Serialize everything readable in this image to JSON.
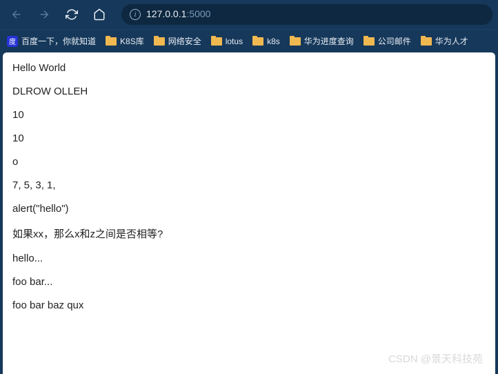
{
  "address": {
    "host": "127.0.0.1",
    "port": ":5000"
  },
  "bookmarks": [
    {
      "label": "百度一下，你就知道",
      "type": "site"
    },
    {
      "label": "K8S库",
      "type": "folder"
    },
    {
      "label": "网络安全",
      "type": "folder"
    },
    {
      "label": "lotus",
      "type": "folder"
    },
    {
      "label": "k8s",
      "type": "folder"
    },
    {
      "label": "华为进度查询",
      "type": "folder"
    },
    {
      "label": "公司邮件",
      "type": "folder"
    },
    {
      "label": "华为人才",
      "type": "folder"
    }
  ],
  "content_lines": [
    "Hello World",
    "DLROW OLLEH",
    "10",
    "10",
    "o",
    "7, 5, 3, 1,",
    "alert(\"hello\")",
    "如果xx，那么x和z之间是否相等?",
    "hello...",
    "foo bar...",
    "foo bar baz qux"
  ],
  "watermark": "CSDN @景天科技苑"
}
